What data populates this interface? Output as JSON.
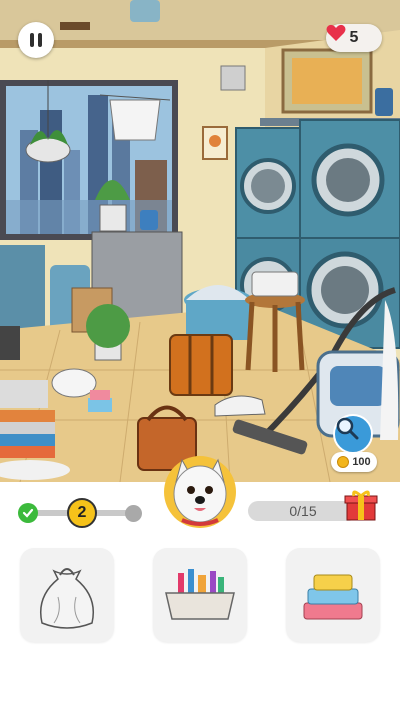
{
  "hud": {
    "pause_icon": "pause-icon",
    "lives": "5",
    "heart_color": "#e8304a",
    "hint_cost": "100"
  },
  "progress": {
    "current_level": "2",
    "found_count": "0/15",
    "completed_color": "#3cba3c",
    "current_color": "#f6c21a"
  },
  "items": [
    {
      "name": "sack",
      "icon": "sack-icon"
    },
    {
      "name": "cosmetic-bag",
      "icon": "cosmetic-bag-icon"
    },
    {
      "name": "stacked-soap-boxes",
      "icon": "soap-boxes-icon"
    }
  ]
}
